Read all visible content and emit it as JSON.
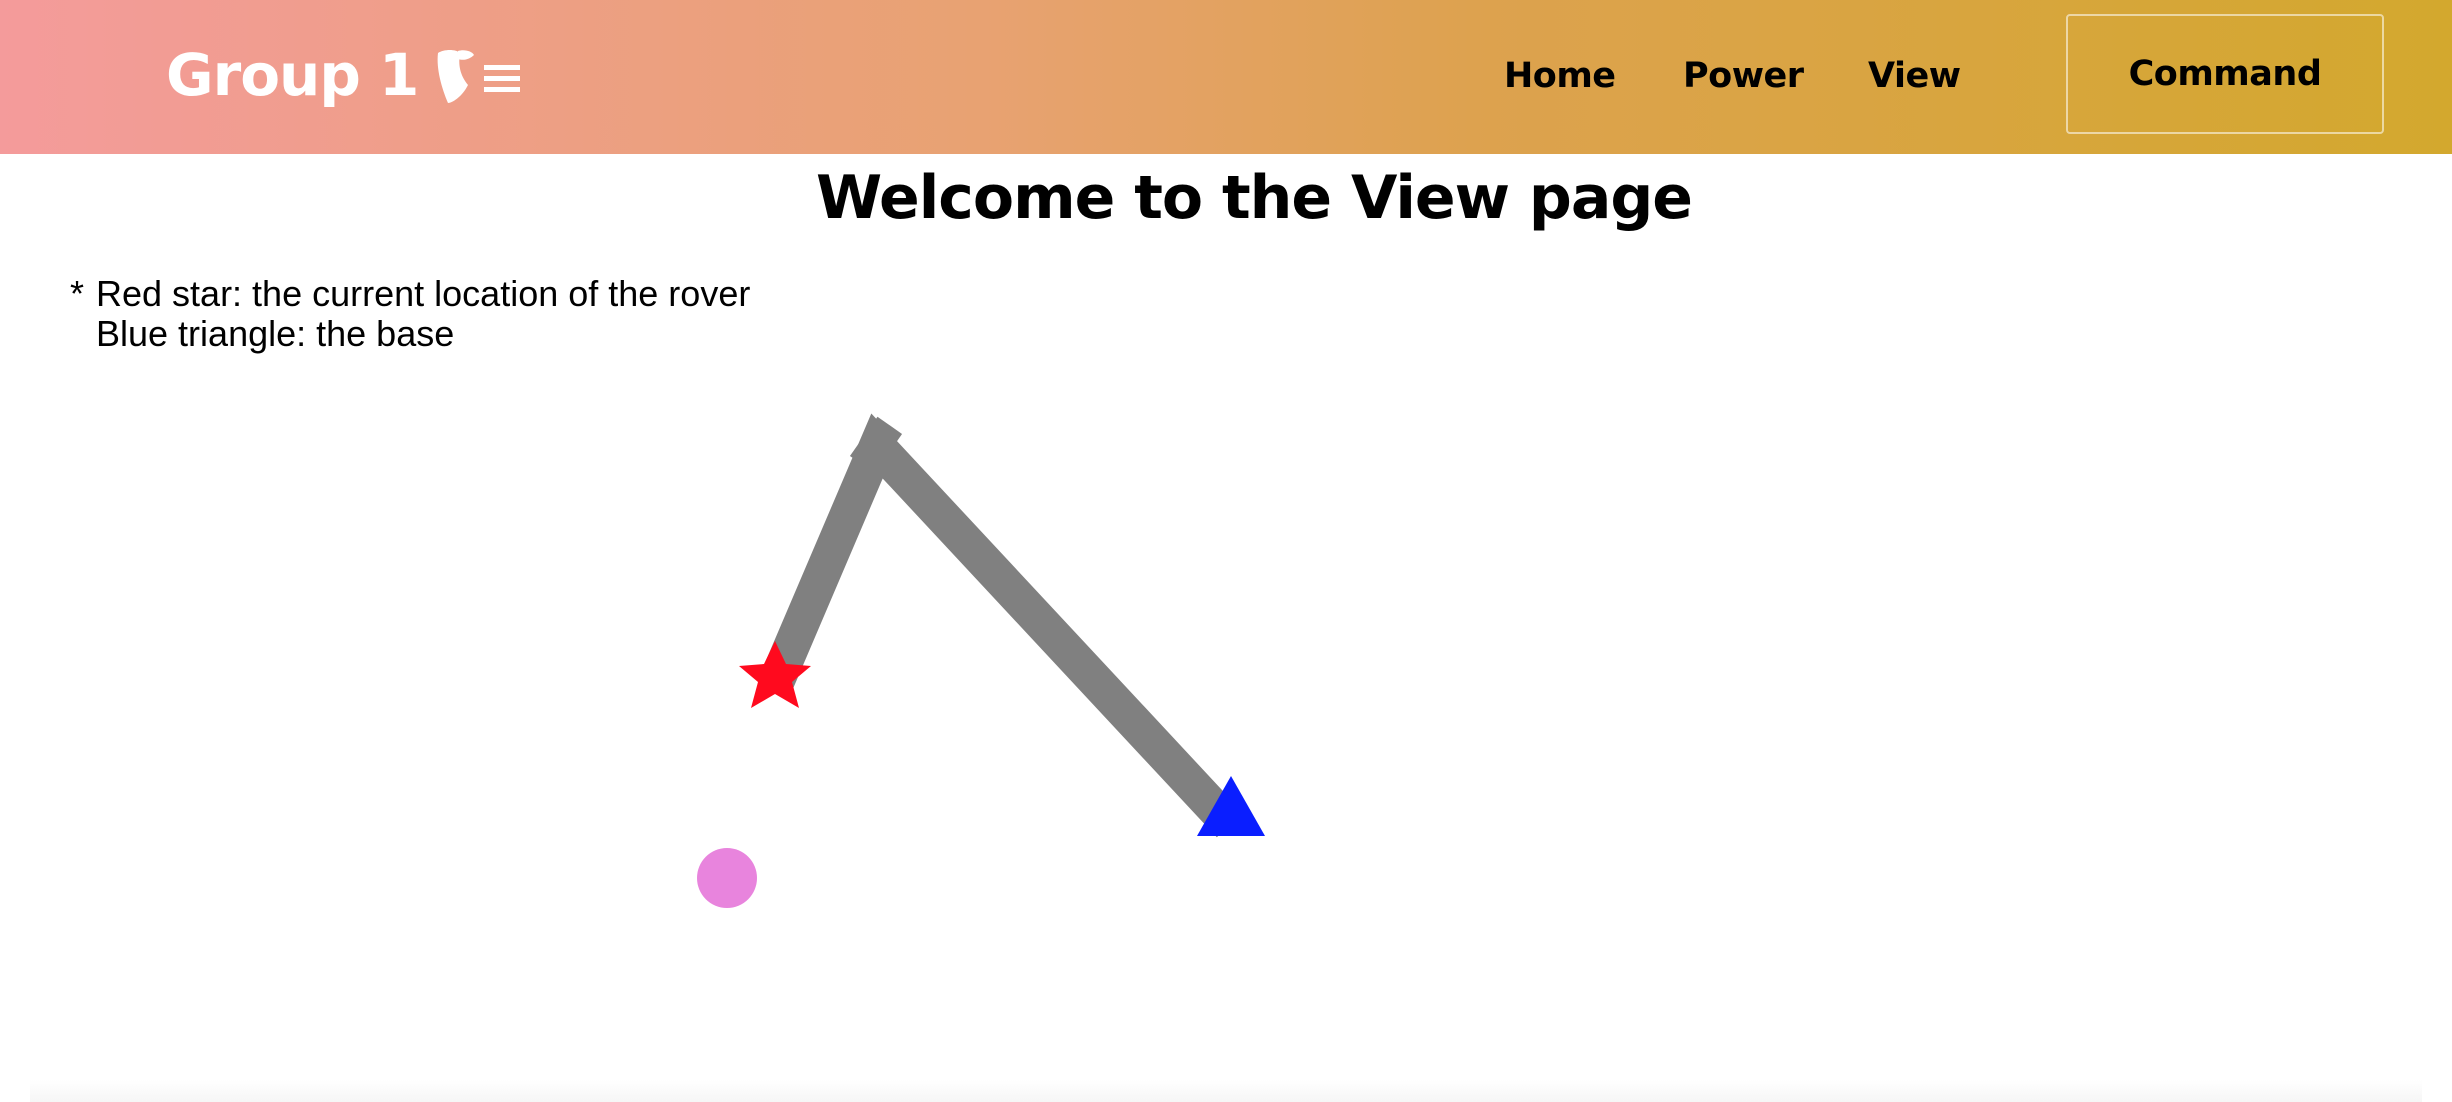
{
  "header": {
    "brand_title": "Group 1",
    "brand_logo_icon": "typo3-menu-icon",
    "nav": [
      {
        "label": "Home"
      },
      {
        "label": "Power"
      },
      {
        "label": "View"
      }
    ],
    "command_label": "Command",
    "gradient_colors": [
      "#f49b9b",
      "#e8a272",
      "#dda24f",
      "#d3a82e"
    ]
  },
  "main": {
    "title": "Welcome to the View page",
    "legend": {
      "bullet": "*",
      "line1": "Red star: the current location of the rover",
      "line2": "Blue triangle: the base"
    }
  },
  "map": {
    "path_color": "#808080",
    "rover_color": "#ff0a1e",
    "rover_icon": "star-icon",
    "base_color": "#0a1eff",
    "base_icon": "triangle-icon",
    "marker_color": "#e884dd",
    "marker_icon": "circle-icon"
  }
}
